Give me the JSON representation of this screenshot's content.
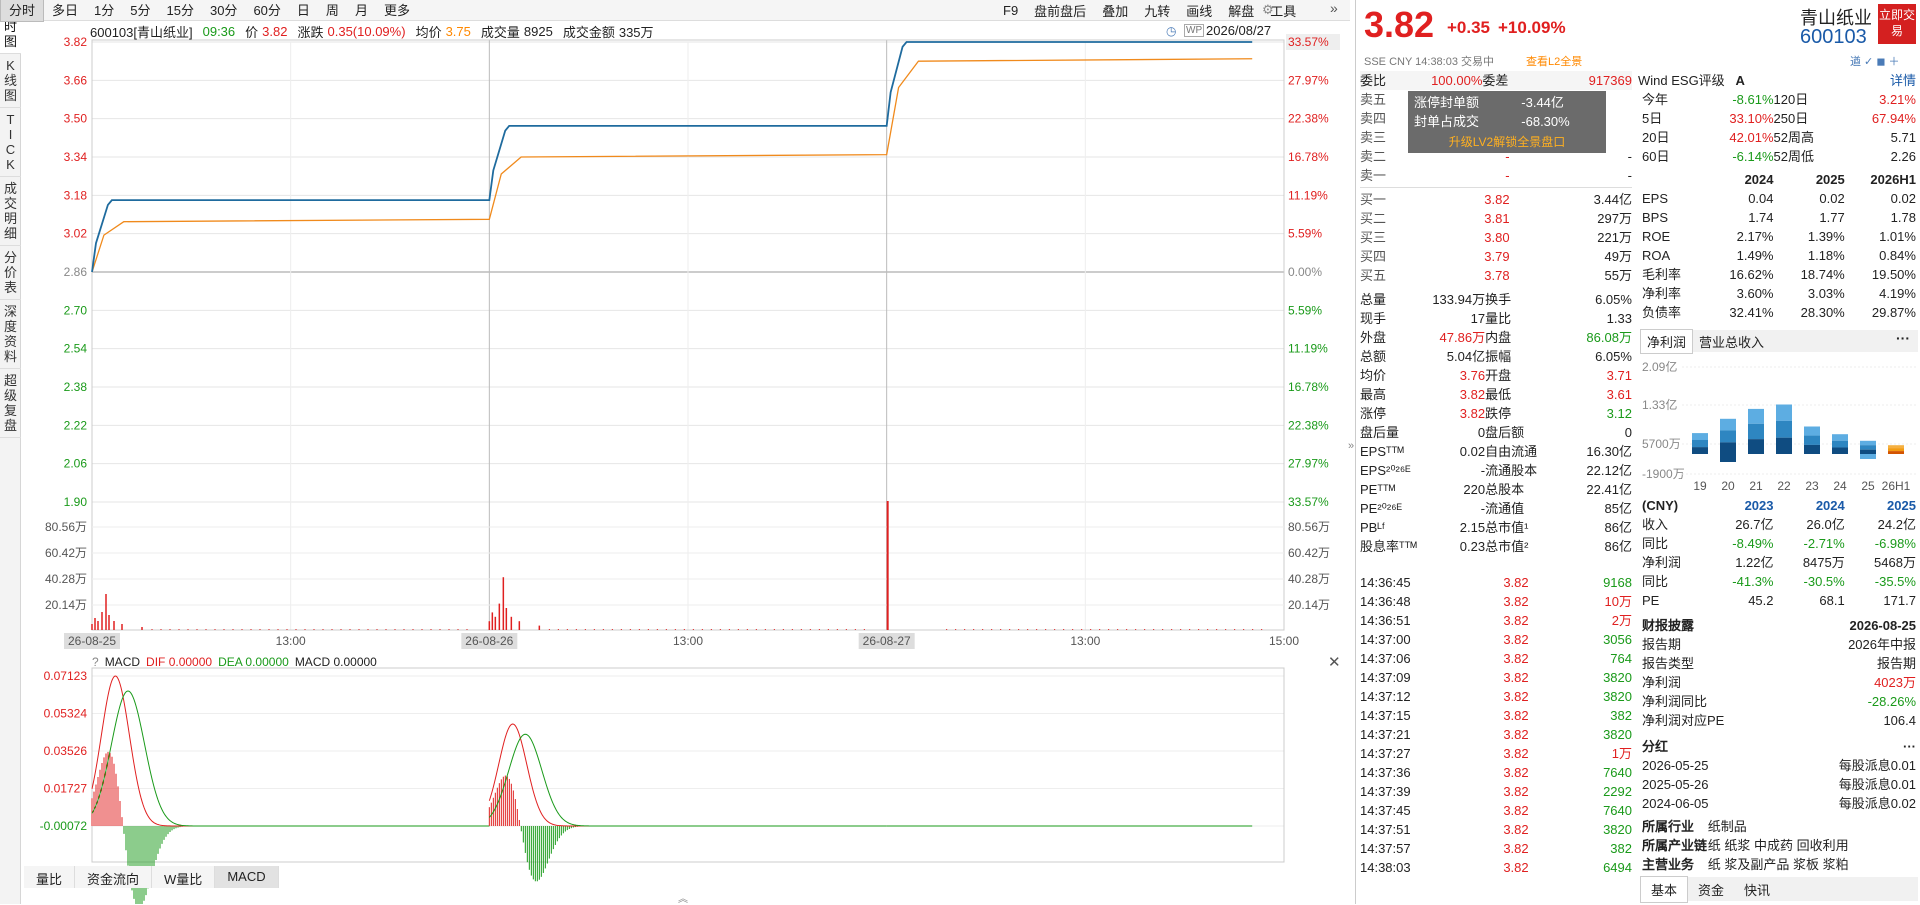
{
  "left_tabs": [
    "分时图",
    "K线图",
    "TICK",
    "成交明细",
    "分价表",
    "深度资料",
    "超级复盘"
  ],
  "periods": [
    "分时",
    "多日",
    "1分",
    "5分",
    "15分",
    "30分",
    "60分",
    "日",
    "周",
    "月",
    "更多"
  ],
  "tools": [
    "F9",
    "盘前盘后",
    "叠加",
    "九转",
    "画线",
    "解盘",
    "工具"
  ],
  "info": {
    "code_name": "600103[青山纸业]",
    "time": "09:36",
    "price_label": "价",
    "price": "3.82",
    "chg_label": "涨跌",
    "chg": "0.35(10.09%)",
    "avg_label": "均价",
    "avg": "3.75",
    "vol_label": "成交量",
    "vol": "8925",
    "amt_label": "成交金额",
    "amt": "335万"
  },
  "date": "2026/08/27",
  "y_left": [
    "3.82",
    "3.66",
    "3.50",
    "3.34",
    "3.18",
    "3.02",
    "2.86",
    "2.70",
    "2.54",
    "2.38",
    "2.22",
    "2.06",
    "1.90"
  ],
  "y_right": [
    "33.57%",
    "27.97%",
    "22.38%",
    "16.78%",
    "11.19%",
    "5.59%",
    "0.00%",
    "5.59%",
    "11.19%",
    "16.78%",
    "22.38%",
    "27.97%",
    "33.57%"
  ],
  "vol_left": [
    "80.56万",
    "60.42万",
    "40.28万",
    "20.14万"
  ],
  "x_labels": [
    "26-08-25",
    "13:00",
    "26-08-26",
    "13:00",
    "26-08-27",
    "13:00",
    "15:00"
  ],
  "macd": {
    "title": "MACD",
    "dif": "DIF 0.00000",
    "dea": "DEA 0.00000",
    "macd": "MACD 0.00000",
    "y": [
      "0.07123",
      "0.05324",
      "0.03526",
      "0.01727",
      "-0.00072"
    ]
  },
  "bottom_tabs": [
    "量比",
    "资金流向",
    "W量比",
    "MACD"
  ],
  "chart_data": {
    "type": "line",
    "title": "",
    "x": [
      "26-08-25",
      "26-08-26",
      "26-08-27"
    ],
    "series": [
      {
        "name": "价格",
        "values": [
          3.16,
          3.47,
          3.82
        ]
      },
      {
        "name": "均价",
        "values": [
          3.08,
          3.35,
          3.75
        ]
      }
    ],
    "ylim": [
      1.9,
      3.82
    ],
    "prev_close": 2.86
  },
  "quote": {
    "price": "3.82",
    "chg": "+0.35",
    "pct": "+10.09%",
    "name": "青山纸业",
    "code": "600103",
    "trade_btn": "立即交易",
    "sub": "SSE  CNY  14:38:03  交易中",
    "l2": "查看L2全景"
  },
  "book": {
    "wb_label": "委比",
    "wb": "100.00%",
    "wc_label": "委差",
    "wc": "917369",
    "sells": [
      [
        "卖五",
        "",
        ""
      ],
      [
        "卖四",
        "",
        ""
      ],
      [
        "卖三",
        "",
        ""
      ],
      [
        "卖二",
        "-",
        "-"
      ],
      [
        "卖一",
        "-",
        "-"
      ]
    ],
    "overlay": [
      [
        "涨停封单额",
        "-",
        "3.44亿"
      ],
      [
        "封单占成交",
        "-",
        "68.30%"
      ]
    ],
    "overlay_link": "升级LV2解锁全景盘口",
    "buys": [
      [
        "买一",
        "3.82",
        "3.44亿"
      ],
      [
        "买二",
        "3.81",
        "297万"
      ],
      [
        "买三",
        "3.80",
        "221万"
      ],
      [
        "买四",
        "3.79",
        "49万"
      ],
      [
        "买五",
        "3.78",
        "55万"
      ]
    ]
  },
  "stats": [
    [
      "总量",
      "133.94万",
      "换手",
      "6.05%"
    ],
    [
      "现手",
      "17",
      "量比",
      "1.33"
    ],
    [
      "外盘",
      "47.86万",
      "内盘",
      "86.08万"
    ],
    [
      "总额",
      "5.04亿",
      "振幅",
      "6.05%"
    ],
    [
      "均价",
      "3.76",
      "开盘",
      "3.71"
    ],
    [
      "最高",
      "3.82",
      "最低",
      "3.61"
    ],
    [
      "涨停",
      "3.82",
      "跌停",
      "3.12"
    ],
    [
      "盘后量",
      "0",
      "盘后额",
      "0"
    ],
    [
      "EPSᵀᵀᴹ",
      "0.02",
      "自由流通",
      "16.30亿"
    ],
    [
      "EPS²⁰²⁶ᴱ",
      "-",
      "流通股本",
      "22.12亿"
    ],
    [
      "PEᵀᵀᴹ",
      "220",
      "总股本",
      "22.41亿"
    ],
    [
      "PE²⁰²⁶ᴱ",
      "-",
      "流通值",
      "85亿"
    ],
    [
      "PBᴸᶠ",
      "2.15",
      "总市值¹",
      "86亿"
    ],
    [
      "股息率ᵀᵀᴹ",
      "0.23",
      "总市值²",
      "86亿"
    ]
  ],
  "ticks": [
    [
      "14:36:45",
      "3.82",
      "9168"
    ],
    [
      "14:36:48",
      "3.82",
      "10万"
    ],
    [
      "14:36:51",
      "3.82",
      "2万"
    ],
    [
      "14:37:00",
      "3.82",
      "3056"
    ],
    [
      "14:37:06",
      "3.82",
      "764"
    ],
    [
      "14:37:09",
      "3.82",
      "3820"
    ],
    [
      "14:37:12",
      "3.82",
      "3820"
    ],
    [
      "14:37:15",
      "3.82",
      "382"
    ],
    [
      "14:37:21",
      "3.82",
      "3820"
    ],
    [
      "14:37:27",
      "3.82",
      "1万"
    ],
    [
      "14:37:36",
      "3.82",
      "7640"
    ],
    [
      "14:37:39",
      "3.82",
      "2292"
    ],
    [
      "14:37:45",
      "3.82",
      "7640"
    ],
    [
      "14:37:51",
      "3.82",
      "3820"
    ],
    [
      "14:37:57",
      "3.82",
      "382"
    ],
    [
      "14:38:03",
      "3.82",
      "6494"
    ]
  ],
  "esg": {
    "label": "Wind ESG评级",
    "grade": "A",
    "link": "详情"
  },
  "perf": [
    [
      "今年",
      "-8.61%",
      "120日",
      "3.21%"
    ],
    [
      "5日",
      "33.10%",
      "250日",
      "67.94%"
    ],
    [
      "20日",
      "42.01%",
      "52周高",
      "5.71"
    ],
    [
      "60日",
      "-6.14%",
      "52周低",
      "2.26"
    ]
  ],
  "fin_head": [
    "",
    "2024",
    "2025",
    "2026H1"
  ],
  "fin": [
    [
      "EPS",
      "0.04",
      "0.02",
      "0.02"
    ],
    [
      "BPS",
      "1.74",
      "1.77",
      "1.78"
    ],
    [
      "ROE",
      "2.17%",
      "1.39%",
      "1.01%"
    ],
    [
      "ROA",
      "1.49%",
      "1.18%",
      "0.84%"
    ],
    [
      "毛利率",
      "16.62%",
      "18.74%",
      "19.50%"
    ],
    [
      "净利率",
      "3.60%",
      "3.03%",
      "4.19%"
    ],
    [
      "负债率",
      "32.41%",
      "28.30%",
      "29.87%"
    ]
  ],
  "profit_tabs": [
    "净利润",
    "营业总收入"
  ],
  "profit_y": [
    "2.09亿",
    "1.33亿",
    "5700万",
    "-1900万"
  ],
  "profit_x": [
    "19",
    "20",
    "21",
    "22",
    "23",
    "24",
    "25",
    "26H1"
  ],
  "profit_bars": [
    0.95,
    1.6,
    2.05,
    2.25,
    1.25,
    0.9,
    0.6,
    0.4
  ],
  "rev_head": [
    "(CNY)",
    "2023",
    "2024",
    "2025"
  ],
  "rev": [
    [
      "收入",
      "26.7亿",
      "26.0亿",
      "24.2亿"
    ],
    [
      "同比",
      "-8.49%",
      "-2.71%",
      "-6.98%"
    ],
    [
      "净利润",
      "1.22亿",
      "8475万",
      "5468万"
    ],
    [
      "同比",
      "-41.3%",
      "-30.5%",
      "-35.5%"
    ],
    [
      "PE",
      "45.2",
      "68.1",
      "171.7"
    ]
  ],
  "report": {
    "title": "财报披露",
    "date": "2026-08-25",
    "rows": [
      [
        "报告期",
        "2026年中报"
      ],
      [
        "报告类型",
        "报告期"
      ],
      [
        "净利润",
        "4023万"
      ],
      [
        "净利润同比",
        "-28.26%"
      ],
      [
        "净利润对应PE",
        "106.4"
      ]
    ]
  },
  "div": {
    "title": "分红",
    "rows": [
      [
        "2026-05-25",
        "每股派息0.01"
      ],
      [
        "2025-05-26",
        "每股派息0.01"
      ],
      [
        "2024-06-05",
        "每股派息0.02"
      ]
    ]
  },
  "industry": [
    [
      "所属行业",
      "纸制品"
    ],
    [
      "所属产业链",
      "纸  纸浆  中成药  回收利用"
    ],
    [
      "主营业务",
      "纸  浆及副产品  浆板  浆粕"
    ]
  ],
  "rtabs": [
    "基本",
    "资金",
    "快讯"
  ]
}
